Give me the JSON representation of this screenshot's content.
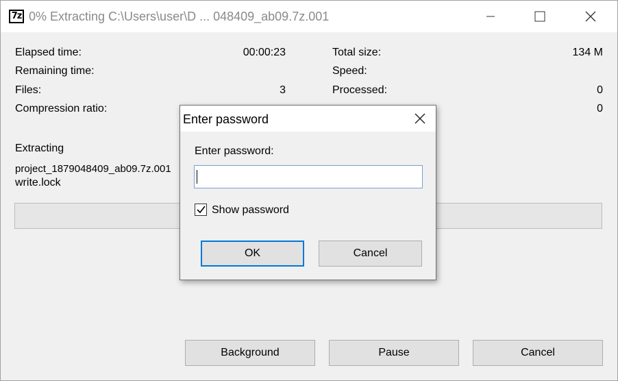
{
  "window": {
    "app_icon_text": "7z",
    "title": "0% Extracting C:\\Users\\user\\D ... 048409_ab09.7z.001"
  },
  "stats": {
    "elapsed_label": "Elapsed time:",
    "elapsed_value": "00:00:23",
    "remaining_label": "Remaining time:",
    "remaining_value": "",
    "files_label": "Files:",
    "files_value": "3",
    "ratio_label": "Compression ratio:",
    "total_size_label": "Total size:",
    "total_size_value": "134 M",
    "speed_label": "Speed:",
    "speed_value": "",
    "processed_label": "Processed:",
    "processed_value": "0",
    "compressed_value": "0"
  },
  "extract": {
    "label": "Extracting",
    "archive_name": "project_1879048409_ab09.7z.001",
    "current_file": "write.lock",
    "progress_percent": 0
  },
  "buttons": {
    "background": "Background",
    "pause": "Pause",
    "cancel": "Cancel"
  },
  "dialog": {
    "title": "Enter password",
    "prompt": "Enter password:",
    "password_value": "",
    "show_password_label": "Show password",
    "show_password_checked": true,
    "ok": "OK",
    "cancel": "Cancel"
  }
}
